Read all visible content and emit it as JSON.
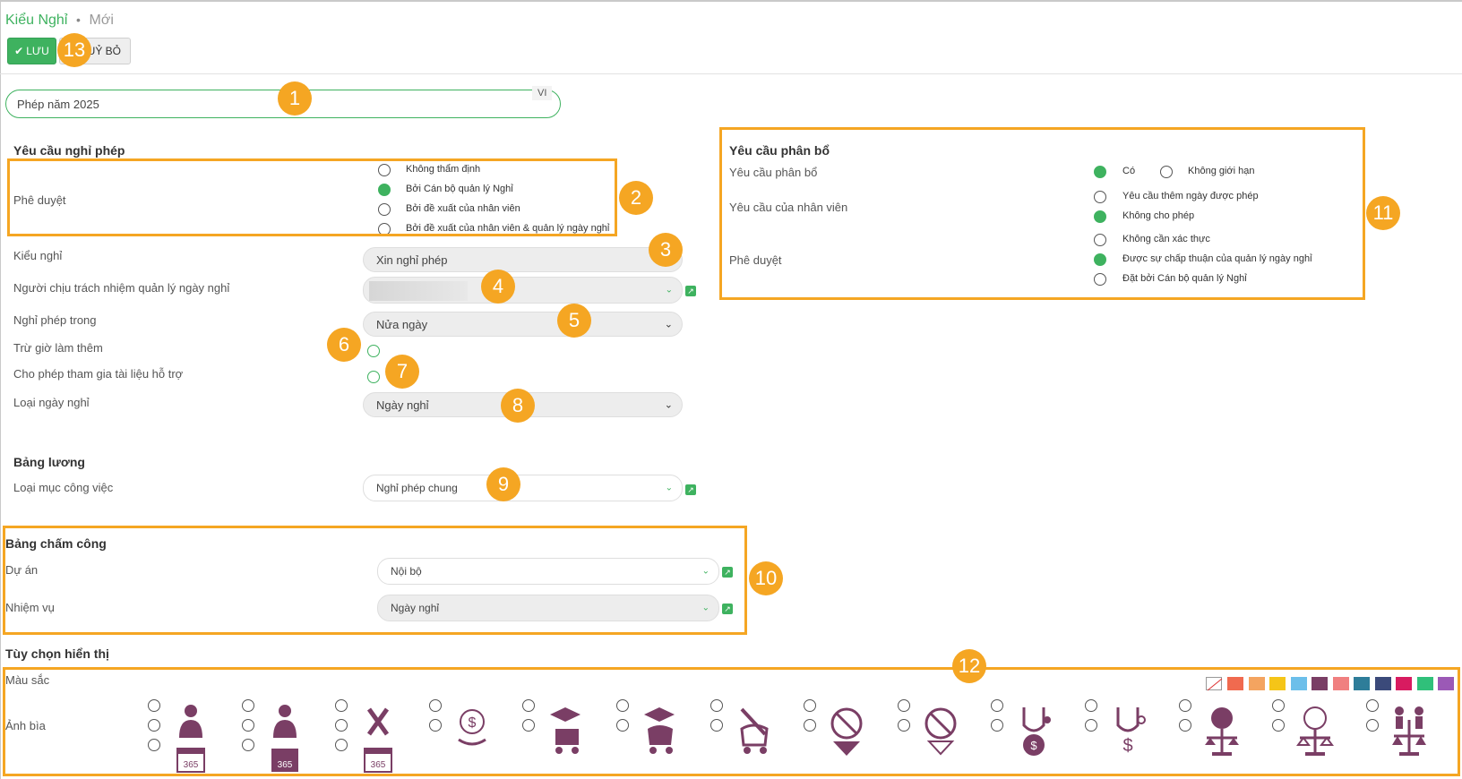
{
  "breadcrumb": {
    "title": "Kiểu Nghỉ",
    "separator": "•",
    "sub": "Mới"
  },
  "toolbar": {
    "save_label": "LƯU",
    "cancel_label": "HUỶ BỎ"
  },
  "name_field": {
    "value": "Phép năm 2025",
    "lang": "VI"
  },
  "leave_request": {
    "section_title": "Yêu cầu nghỉ phép",
    "approval_label": "Phê duyệt",
    "approval_options": [
      "Không thẩm định",
      "Bởi Cán bộ quản lý Nghỉ",
      "Bởi đề xuất của nhân viên",
      "Bởi đề xuất của nhân viên & quản lý ngày nghỉ"
    ],
    "approval_selected": 1,
    "leave_type_label": "Kiểu nghỉ",
    "leave_type_value": "Xin nghỉ phép",
    "manager_label": "Người chịu trách nhiệm quản lý ngày nghỉ",
    "period_label": "Nghỉ phép trong",
    "period_value": "Nửa ngày",
    "overtime_label": "Trừ giờ làm thêm",
    "support_doc_label": "Cho phép tham gia tài liệu hỗ trợ",
    "day_type_label": "Loại ngày nghỉ",
    "day_type_value": "Ngày nghỉ"
  },
  "payroll": {
    "section_title": "Bảng lương",
    "work_entry_label": "Loại mục công việc",
    "work_entry_value": "Nghỉ phép chung"
  },
  "timesheet": {
    "section_title": "Bảng chấm công",
    "project_label": "Dự án",
    "project_value": "Nội bộ",
    "task_label": "Nhiệm vụ",
    "task_value": "Ngày nghỉ"
  },
  "display": {
    "section_title": "Tùy chọn hiển thị",
    "color_label": "Màu sắc",
    "cover_label": "Ảnh bìa",
    "colors": [
      "#f06a4f",
      "#f4a460",
      "#f5c518",
      "#6cbfea",
      "#7a3e65",
      "#f08080",
      "#2e7d99",
      "#3b4a7a",
      "#d81b60",
      "#30c07a",
      "#9b59b6"
    ],
    "icons": [
      "injured-365-icon",
      "worker-365-icon",
      "holiday-365-icon",
      "pay-hand-icon",
      "graduation-stroller-icon",
      "graduation-stroller-2-icon",
      "no-work-stroller-icon",
      "no-food-icon",
      "no-extra-icon",
      "medical-dollar-icon",
      "medical-dollar-2-icon",
      "scale-clock-icon",
      "scale-clock-2-icon",
      "scale-people-icon"
    ]
  },
  "allocation": {
    "section_title": "Yêu cầu phân bổ",
    "alloc_label": "Yêu cầu phân bổ",
    "alloc_options": [
      "Có",
      "Không giới hạn"
    ],
    "alloc_selected": 0,
    "employee_label": "Yêu cầu của nhân viên",
    "employee_options": [
      "Yêu cầu thêm ngày được phép",
      "Không cho phép"
    ],
    "employee_selected": 1,
    "approval_label": "Phê duyệt",
    "approval_options": [
      "Không cần xác thực",
      "Được sự chấp thuận của quản lý ngày nghỉ",
      "Đặt bởi Cán bộ quản lý Nghỉ"
    ],
    "approval_selected": 1
  },
  "badges": [
    "1",
    "2",
    "3",
    "4",
    "5",
    "6",
    "7",
    "8",
    "9",
    "10",
    "11",
    "12",
    "13"
  ]
}
